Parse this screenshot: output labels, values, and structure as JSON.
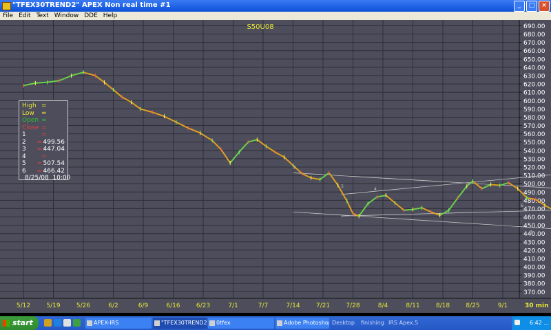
{
  "window": {
    "title": "\"TFEX30TREND2\" APEX Non real time #1",
    "buttons": [
      "_",
      "□",
      "×"
    ]
  },
  "menu": [
    "File",
    "Edit",
    "Text",
    "Window",
    "DDE",
    "Help"
  ],
  "chart_data": {
    "type": "line",
    "title": "S50U08",
    "y_ticks": [
      "690.00",
      "680.00",
      "670.00",
      "660.00",
      "650.00",
      "640.00",
      "630.00",
      "620.00",
      "610.00",
      "600.00",
      "590.00",
      "580.00",
      "570.00",
      "560.00",
      "550.00",
      "540.00",
      "530.00",
      "520.00",
      "510.00",
      "500.00",
      "490.00",
      "480.00",
      "470.00",
      "460.00",
      "450.00",
      "440.00",
      "430.00",
      "420.00",
      "410.00",
      "400.00",
      "390.00",
      "380.00",
      "370.00"
    ],
    "ylim": [
      362,
      697
    ],
    "x_ticks": [
      "5/12",
      "5/19",
      "5/26",
      "6/2",
      "6/9",
      "6/16",
      "6/23",
      "7/1",
      "7/7",
      "7/14",
      "7/21",
      "7/28",
      "8/4",
      "8/11",
      "8/18",
      "8/25",
      "9/1"
    ],
    "interval_label": "30 min",
    "series": [
      {
        "values": [
          [
            0,
            618
          ],
          [
            0.4,
            621
          ],
          [
            0.8,
            622
          ],
          [
            1.2,
            624
          ],
          [
            1.6,
            630
          ],
          [
            2.0,
            634
          ],
          [
            2.4,
            630
          ],
          [
            2.7,
            622
          ],
          [
            3.0,
            613
          ],
          [
            3.3,
            604
          ],
          [
            3.6,
            598
          ],
          [
            3.9,
            590
          ],
          [
            4.3,
            586
          ],
          [
            4.7,
            581
          ],
          [
            5.1,
            574
          ],
          [
            5.5,
            567
          ],
          [
            5.9,
            561
          ],
          [
            6.3,
            552
          ],
          [
            6.6,
            541
          ],
          [
            6.9,
            525
          ],
          [
            7.2,
            538
          ],
          [
            7.5,
            550
          ],
          [
            7.8,
            553
          ],
          [
            8.1,
            545
          ],
          [
            8.4,
            538
          ],
          [
            8.7,
            532
          ],
          [
            9.0,
            522
          ],
          [
            9.3,
            512
          ],
          [
            9.6,
            507
          ],
          [
            9.9,
            505
          ],
          [
            10.2,
            513
          ],
          [
            10.5,
            498
          ],
          [
            10.8,
            479
          ],
          [
            11.0,
            464
          ],
          [
            11.2,
            461
          ],
          [
            11.5,
            476
          ],
          [
            11.8,
            484
          ],
          [
            12.1,
            486
          ],
          [
            12.4,
            477
          ],
          [
            12.7,
            468
          ],
          [
            13.0,
            469
          ],
          [
            13.3,
            471
          ],
          [
            13.6,
            466
          ],
          [
            13.9,
            462
          ],
          [
            14.2,
            468
          ],
          [
            14.5,
            483
          ],
          [
            14.8,
            497
          ],
          [
            15.0,
            503
          ],
          [
            15.3,
            494
          ],
          [
            15.6,
            499
          ],
          [
            15.9,
            498
          ],
          [
            16.2,
            501
          ],
          [
            16.5,
            494
          ],
          [
            16.8,
            483
          ],
          [
            17.1,
            481
          ],
          [
            17.4,
            474
          ],
          [
            17.7,
            468
          ],
          [
            18.0,
            474
          ]
        ]
      }
    ],
    "wave_labels": [
      "2",
      "5",
      "4",
      "6",
      "3"
    ],
    "info_panel": {
      "rows": [
        {
          "label": "High",
          "eq": "=",
          "value": ""
        },
        {
          "label": "Low",
          "eq": "=",
          "value": ""
        },
        {
          "label": "Open",
          "eq": "=",
          "value": ""
        },
        {
          "label": "Close",
          "eq": "=",
          "value": ""
        },
        {
          "label": "1",
          "eq": "=",
          "value": ""
        },
        {
          "label": "2",
          "eq": "=",
          "value": "499.56"
        },
        {
          "label": "3",
          "eq": "=",
          "value": "447.04"
        },
        {
          "label": "4",
          "eq": "=",
          "value": ""
        },
        {
          "label": "5",
          "eq": "=",
          "value": "507.54"
        },
        {
          "label": "6",
          "eq": "=",
          "value": "466.42"
        }
      ],
      "date": "8/25/08",
      "time": "10:00"
    }
  },
  "taskbar": {
    "start": "start",
    "tasks": [
      {
        "label": "APEX-IRS",
        "active": false
      },
      {
        "label": "\"TFEX30TREND2\" ...",
        "active": true
      },
      {
        "label": "0tfex",
        "active": false
      },
      {
        "label": "Adobe Photoshop",
        "active": false
      }
    ],
    "extra": [
      "Desktop",
      "finishing",
      "IRS Apex.5"
    ],
    "clock": "6:42 ..."
  }
}
